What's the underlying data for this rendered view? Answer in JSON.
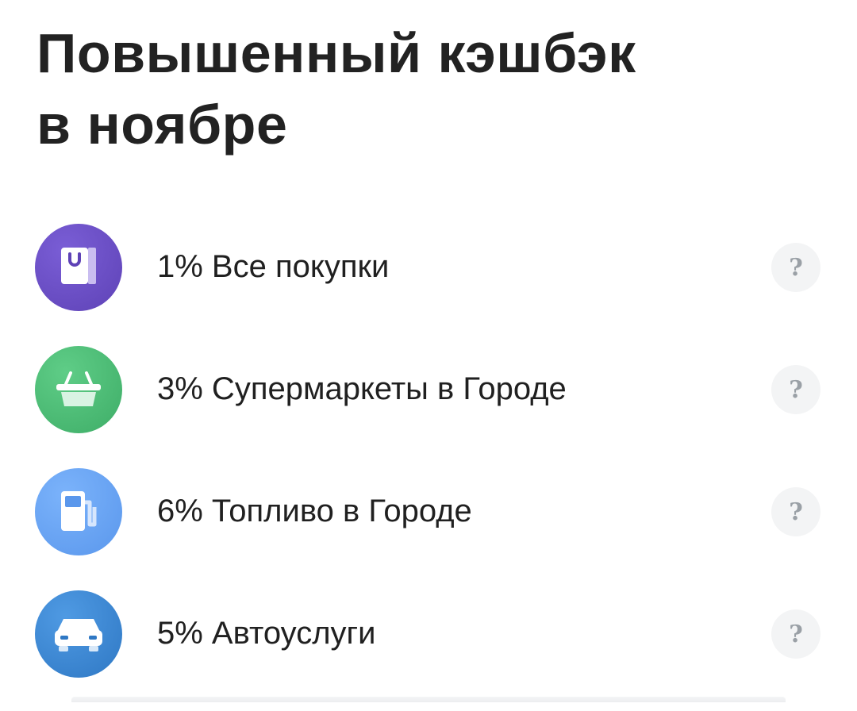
{
  "title": {
    "line1": "Повышенный кэшбэк",
    "line2": "в ноябре"
  },
  "categories": [
    {
      "label": "1% Все покупки",
      "icon": "shopping-bag-icon",
      "color": "#6b4fc4",
      "help": "?"
    },
    {
      "label": "3% Супермаркеты в Городе",
      "icon": "basket-icon",
      "color": "#4fbf78",
      "help": "?"
    },
    {
      "label": "6% Топливо в Городе",
      "icon": "fuel-pump-icon",
      "color": "#6aa5f5",
      "help": "?"
    },
    {
      "label": "5% Автоуслуги",
      "icon": "car-icon",
      "color": "#3e8ad6",
      "help": "?"
    }
  ]
}
